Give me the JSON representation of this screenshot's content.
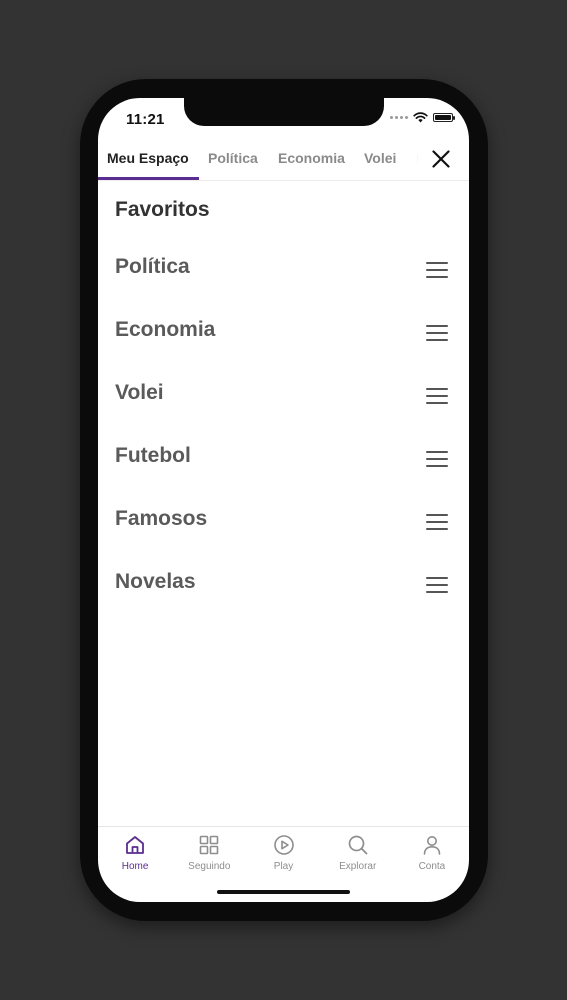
{
  "status_bar": {
    "time": "11:21"
  },
  "tabs": [
    {
      "label": "Meu Espaço",
      "active": true
    },
    {
      "label": "Política",
      "active": false
    },
    {
      "label": "Economia",
      "active": false
    },
    {
      "label": "Volei",
      "active": false
    },
    {
      "label": "F",
      "active": false
    }
  ],
  "section": {
    "title": "Favoritos"
  },
  "favorites": [
    {
      "label": "Política"
    },
    {
      "label": "Economia"
    },
    {
      "label": "Volei"
    },
    {
      "label": "Futebol"
    },
    {
      "label": "Famosos"
    },
    {
      "label": "Novelas"
    }
  ],
  "bottom_nav": [
    {
      "label": "Home",
      "icon": "home-icon",
      "active": true
    },
    {
      "label": "Seguindo",
      "icon": "grid-icon",
      "active": false
    },
    {
      "label": "Play",
      "icon": "play-icon",
      "active": false
    },
    {
      "label": "Explorar",
      "icon": "search-icon",
      "active": false
    },
    {
      "label": "Conta",
      "icon": "user-icon",
      "active": false
    }
  ],
  "colors": {
    "accent": "#5b2d90",
    "background": "#333333",
    "text_primary": "#333333",
    "text_secondary": "#5a5a5a",
    "tab_inactive": "#8a8a8a"
  }
}
